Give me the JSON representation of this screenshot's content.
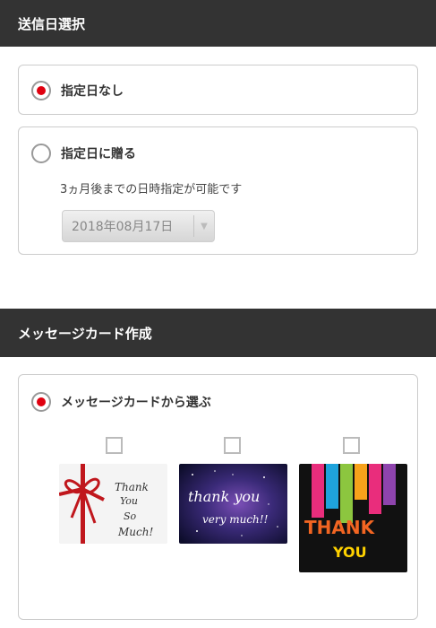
{
  "send_date_section": {
    "title": "送信日選択",
    "option_no_date": {
      "label": "指定日なし",
      "selected": true
    },
    "option_specific_date": {
      "label": "指定日に贈る",
      "selected": false,
      "note": "3ヵ月後までの日時指定が可能です",
      "date_value": "2018年08月17日"
    }
  },
  "message_card_section": {
    "title": "メッセージカード作成",
    "option_choose_card": {
      "label": "メッセージカードから選ぶ",
      "selected": true
    },
    "cards": [
      {
        "name": "red-ribbon-thank-you-so-much",
        "checked": false,
        "text": "Thank You So Much!"
      },
      {
        "name": "galaxy-thank-you-very-much",
        "checked": false,
        "text": "thank you very much!!"
      },
      {
        "name": "colorful-stripes-thank-you",
        "checked": false,
        "text": "THANK YOU"
      }
    ]
  },
  "colors": {
    "header_bg": "#333333",
    "radio_dot": "#e0000f"
  }
}
